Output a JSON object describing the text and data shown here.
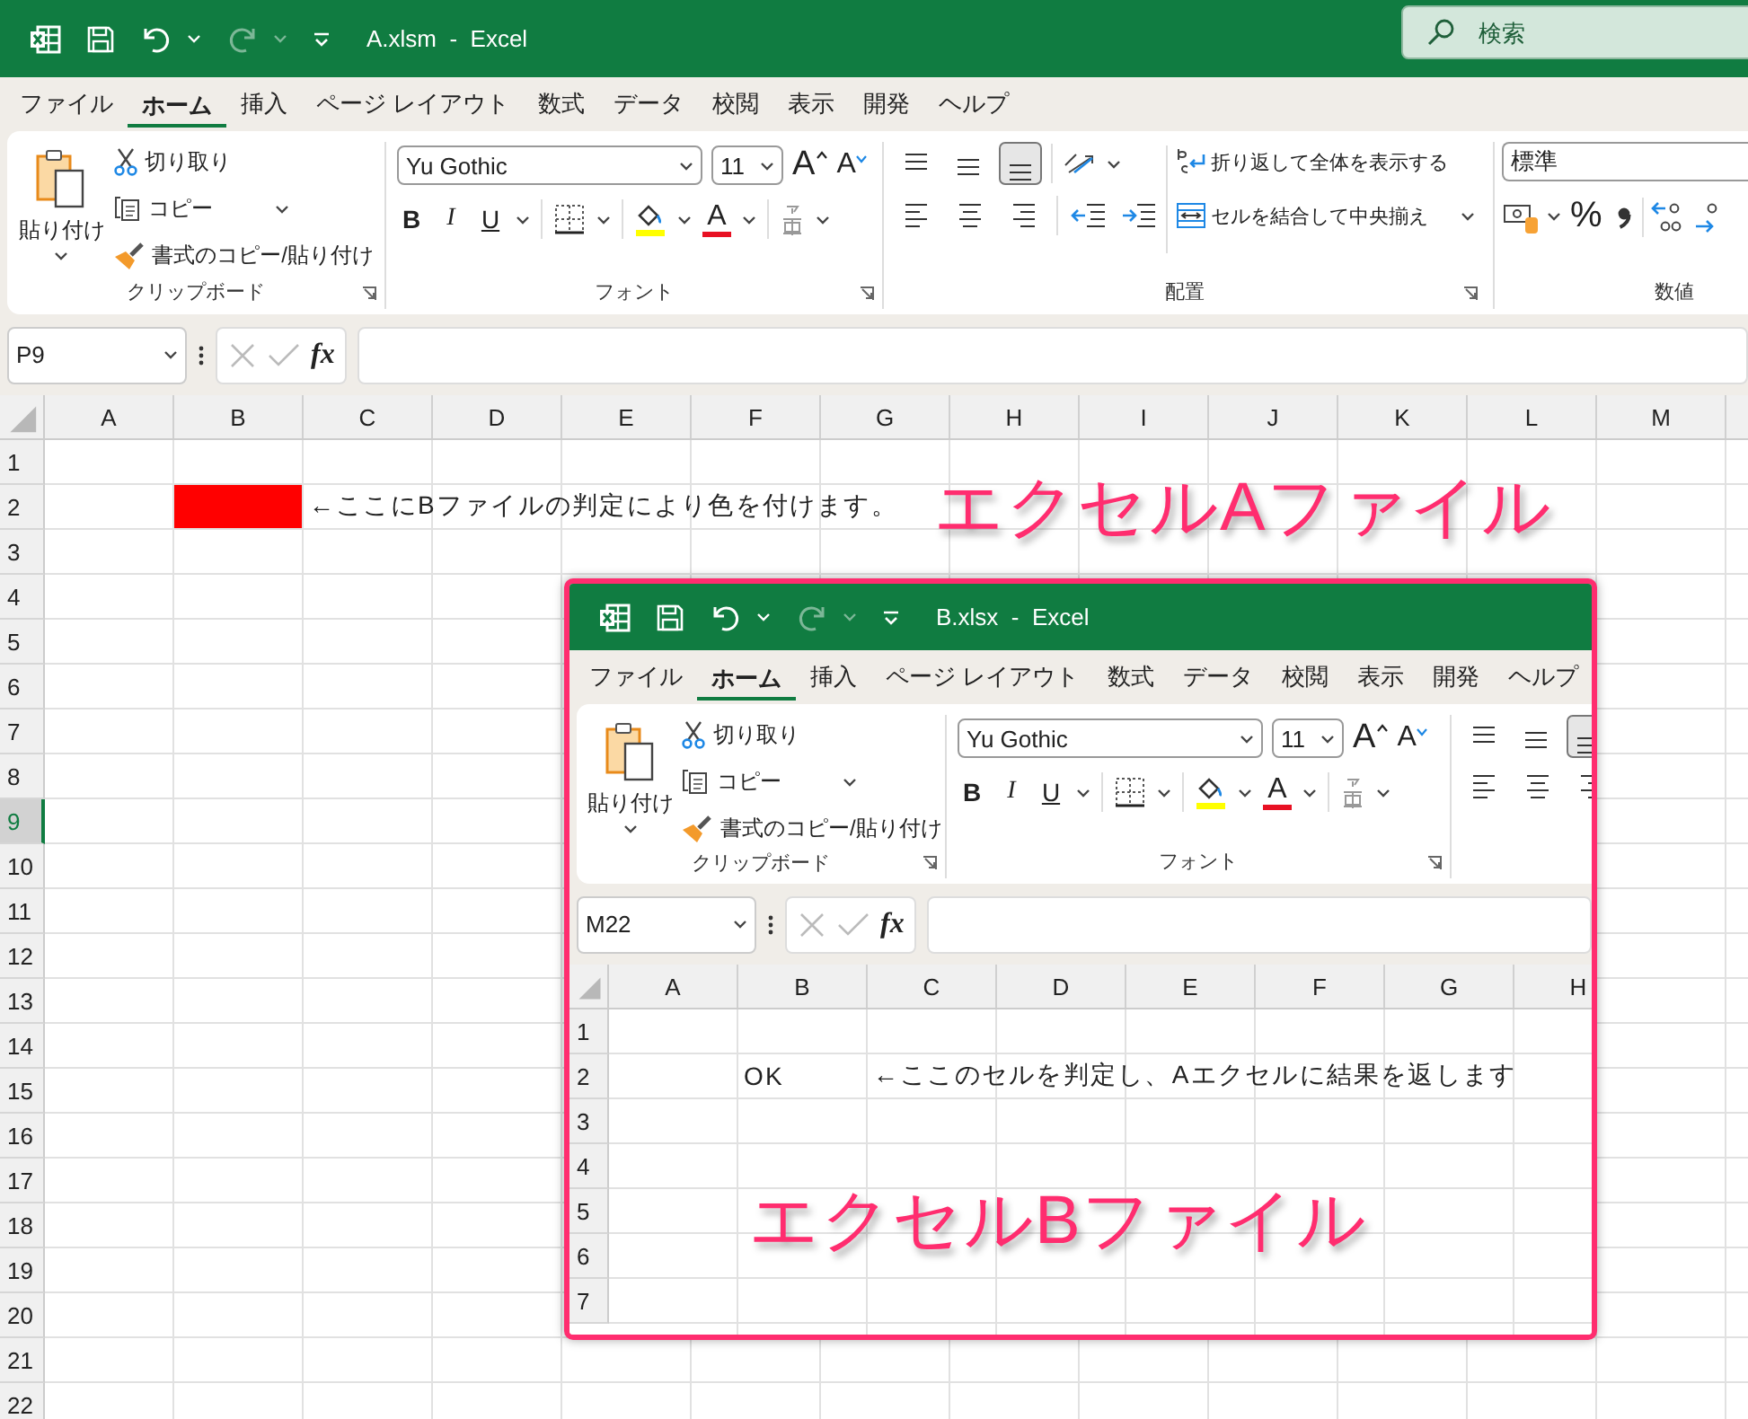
{
  "windows": [
    {
      "title": "A.xlsm  -  Excel",
      "search": {
        "placeholder": "検索"
      },
      "menu_tabs": [
        {
          "label": "ファイル",
          "selected": false
        },
        {
          "label": "ホーム",
          "selected": true
        },
        {
          "label": "挿入",
          "selected": false
        },
        {
          "label": "ページ レイアウト",
          "selected": false
        },
        {
          "label": "数式",
          "selected": false
        },
        {
          "label": "データ",
          "selected": false
        },
        {
          "label": "校閲",
          "selected": false
        },
        {
          "label": "表示",
          "selected": false
        },
        {
          "label": "開発",
          "selected": false
        },
        {
          "label": "ヘルプ",
          "selected": false
        }
      ],
      "ribbon": {
        "clipboard": {
          "paste": "貼り付け",
          "cut": "切り取り",
          "copy": "コピー",
          "format_painter": "書式のコピー/貼り付け",
          "label": "クリップボード"
        },
        "font": {
          "name": "Yu Gothic",
          "size": "11",
          "grow": "A",
          "shrink": "A",
          "bold": "B",
          "italic": "I",
          "underline": "U",
          "font_color": "A",
          "label": "フォント"
        },
        "alignment": {
          "vertical_align": [
            {
              "selected": false
            },
            {
              "selected": false
            },
            {
              "selected": true
            }
          ],
          "wrap": "折り返して全体を表示する",
          "merge": "セルを結合して中央揃え",
          "label": "配置"
        },
        "number": {
          "format": "標準",
          "percent": "%",
          "label": "数値"
        }
      },
      "name_box": "P9",
      "fx": "fx",
      "sheet": {
        "columns": [
          "A",
          "B",
          "C",
          "D",
          "E",
          "F",
          "G",
          "H",
          "I",
          "J",
          "K",
          "L",
          "M"
        ],
        "rows": [
          {
            "label": "1",
            "selected": false
          },
          {
            "label": "2",
            "selected": false,
            "cells": [
              {
                "kind": "blank"
              },
              {
                "kind": "fill",
                "color": "#ff0000"
              },
              {
                "kind": "text",
                "text": "←ここにBファイルの判定により色を付けます。"
              }
            ]
          },
          {
            "label": "3",
            "selected": false
          },
          {
            "label": "4",
            "selected": false
          },
          {
            "label": "5",
            "selected": false
          },
          {
            "label": "6",
            "selected": false
          },
          {
            "label": "7",
            "selected": false
          },
          {
            "label": "8",
            "selected": false
          },
          {
            "label": "9",
            "selected": true
          },
          {
            "label": "10",
            "selected": false
          },
          {
            "label": "11",
            "selected": false
          },
          {
            "label": "12",
            "selected": false
          },
          {
            "label": "13",
            "selected": false
          },
          {
            "label": "14",
            "selected": false
          },
          {
            "label": "15",
            "selected": false
          },
          {
            "label": "16",
            "selected": false
          },
          {
            "label": "17",
            "selected": false
          },
          {
            "label": "18",
            "selected": false
          },
          {
            "label": "19",
            "selected": false
          },
          {
            "label": "20",
            "selected": false
          },
          {
            "label": "21",
            "selected": false
          },
          {
            "label": "22",
            "selected": false
          }
        ],
        "annotation": "エクセルAファイル"
      }
    },
    {
      "title": "B.xlsx  -  Excel",
      "menu_tabs": [
        {
          "label": "ファイル",
          "selected": false
        },
        {
          "label": "ホーム",
          "selected": true
        },
        {
          "label": "挿入",
          "selected": false
        },
        {
          "label": "ページ レイアウト",
          "selected": false
        },
        {
          "label": "数式",
          "selected": false
        },
        {
          "label": "データ",
          "selected": false
        },
        {
          "label": "校閲",
          "selected": false
        },
        {
          "label": "表示",
          "selected": false
        },
        {
          "label": "開発",
          "selected": false
        },
        {
          "label": "ヘルプ",
          "selected": false
        }
      ],
      "ribbon": {
        "clipboard": {
          "paste": "貼り付け",
          "cut": "切り取り",
          "copy": "コピー",
          "format_painter": "書式のコピー/貼り付け",
          "label": "クリップボード"
        },
        "font": {
          "name": "Yu Gothic",
          "size": "11",
          "grow": "A",
          "shrink": "A",
          "bold": "B",
          "italic": "I",
          "underline": "U",
          "font_color": "A",
          "label": "フォント"
        },
        "alignment": {
          "vertical_align": [
            {
              "selected": false
            },
            {
              "selected": false
            },
            {
              "selected": true
            }
          ]
        }
      },
      "name_box": "M22",
      "fx": "fx",
      "sheet": {
        "columns": [
          "A",
          "B",
          "C",
          "D",
          "E",
          "F",
          "G",
          "H"
        ],
        "rows": [
          {
            "label": "1",
            "selected": false
          },
          {
            "label": "2",
            "selected": false,
            "cells": [
              {
                "kind": "blank"
              },
              {
                "kind": "text",
                "text": "OK"
              },
              {
                "kind": "text",
                "text": "←ここのセルを判定し、Aエクセルに結果を返します"
              }
            ]
          },
          {
            "label": "3",
            "selected": false
          },
          {
            "label": "4",
            "selected": false
          },
          {
            "label": "5",
            "selected": false
          },
          {
            "label": "6",
            "selected": false
          },
          {
            "label": "7",
            "selected": false
          }
        ],
        "annotation": "エクセルBファイル"
      }
    }
  ]
}
